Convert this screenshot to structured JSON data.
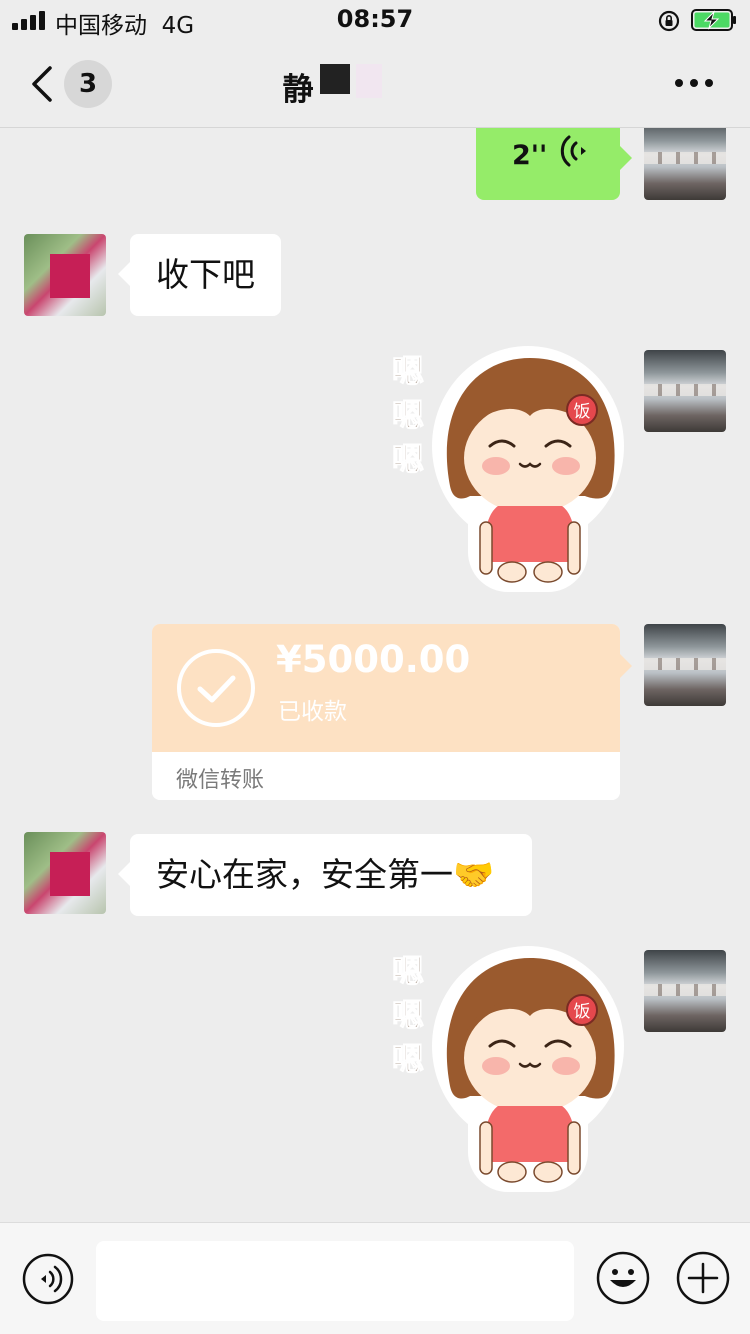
{
  "status_bar": {
    "carrier": "中国移动",
    "network": "4G",
    "time": "08:57"
  },
  "nav": {
    "unread_count": "3",
    "title": "静"
  },
  "messages": {
    "voice_duration": "2''",
    "text_1": "收下吧",
    "sticker_text_1": [
      "嗯",
      "嗯",
      "嗯"
    ],
    "sticker_badge": "饭",
    "transfer": {
      "amount": "¥5000.00",
      "status": "已收款",
      "label": "微信转账"
    },
    "text_2": "安心在家，安全第一🤝",
    "sticker_text_2": [
      "嗯",
      "嗯",
      "嗯"
    ]
  },
  "input": {
    "placeholder": ""
  },
  "colors": {
    "background": "#ededed",
    "voice_bubble": "#95ec69",
    "transfer_card": "#fde1c3",
    "text_bubble": "#ffffff"
  },
  "icons": [
    "signal-icon",
    "rotation-lock-icon",
    "battery-charging-icon",
    "back-icon",
    "more-icon",
    "voice-wave-icon",
    "check-icon",
    "voice-input-icon",
    "emoji-icon",
    "plus-icon"
  ]
}
